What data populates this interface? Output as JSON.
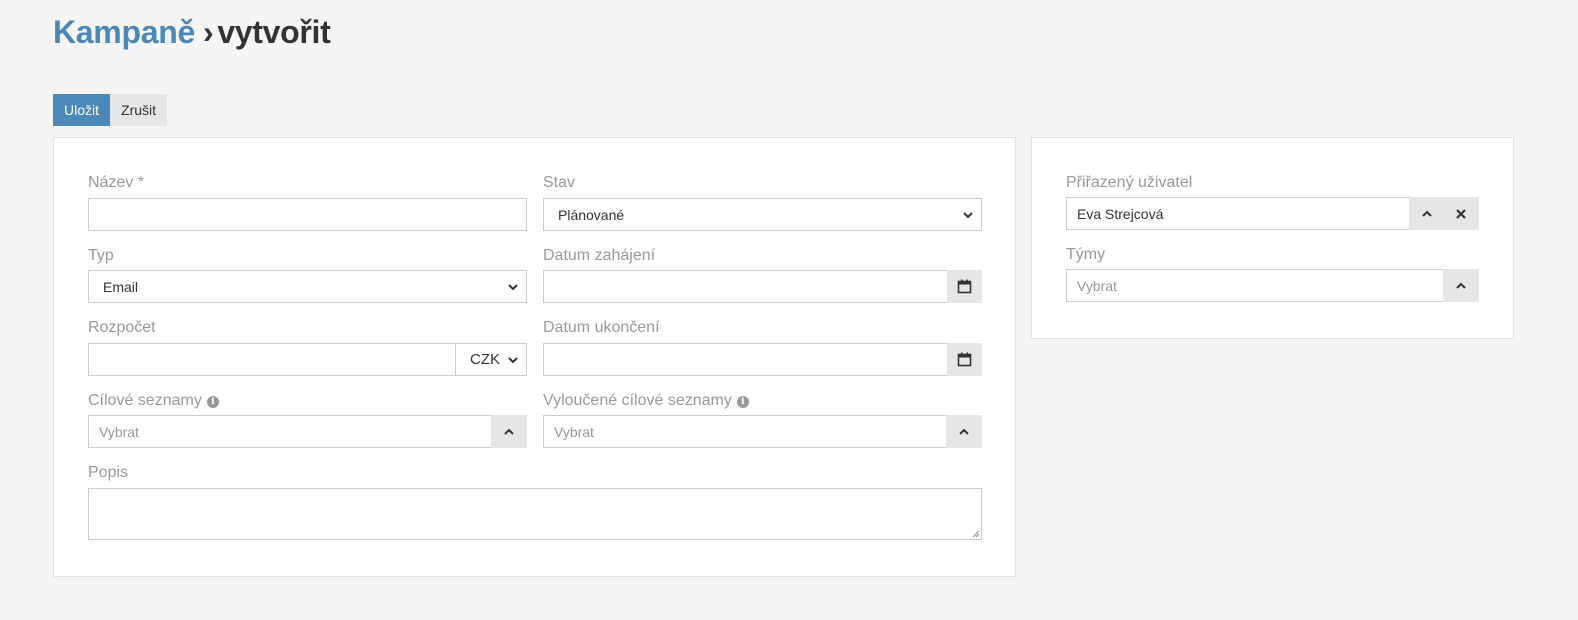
{
  "breadcrumb": {
    "parent": "Kampaně",
    "separator": "›",
    "current": "vytvořit"
  },
  "toolbar": {
    "save_label": "Uložit",
    "cancel_label": "Zrušit"
  },
  "form": {
    "name": {
      "label": "Název *",
      "value": ""
    },
    "status": {
      "label": "Stav",
      "value": "Plánované"
    },
    "type": {
      "label": "Typ",
      "value": "Email"
    },
    "date_start": {
      "label": "Datum zahájení",
      "value": ""
    },
    "budget": {
      "label": "Rozpočet",
      "value": "",
      "currency": "CZK"
    },
    "date_end": {
      "label": "Datum ukončení",
      "value": ""
    },
    "target_lists": {
      "label": "Cílové seznamy",
      "placeholder": "Vybrat"
    },
    "excluded_target_lists": {
      "label": "Vyloučené cílové seznamy",
      "placeholder": "Vybrat"
    },
    "description": {
      "label": "Popis",
      "value": ""
    }
  },
  "side": {
    "assigned_user": {
      "label": "Přiřazený uživatel",
      "value": "Eva Strejcová"
    },
    "teams": {
      "label": "Týmy",
      "placeholder": "Vybrat"
    }
  },
  "colors": {
    "primary": "#4b87b7",
    "background": "#f5f5f5",
    "label": "#999999",
    "addon": "#e6e6e6"
  },
  "icons": {
    "calendar": "calendar-icon",
    "up": "chevron-up-icon",
    "clear": "close-icon",
    "info": "info-icon",
    "dropdown": "chevron-down-icon"
  }
}
